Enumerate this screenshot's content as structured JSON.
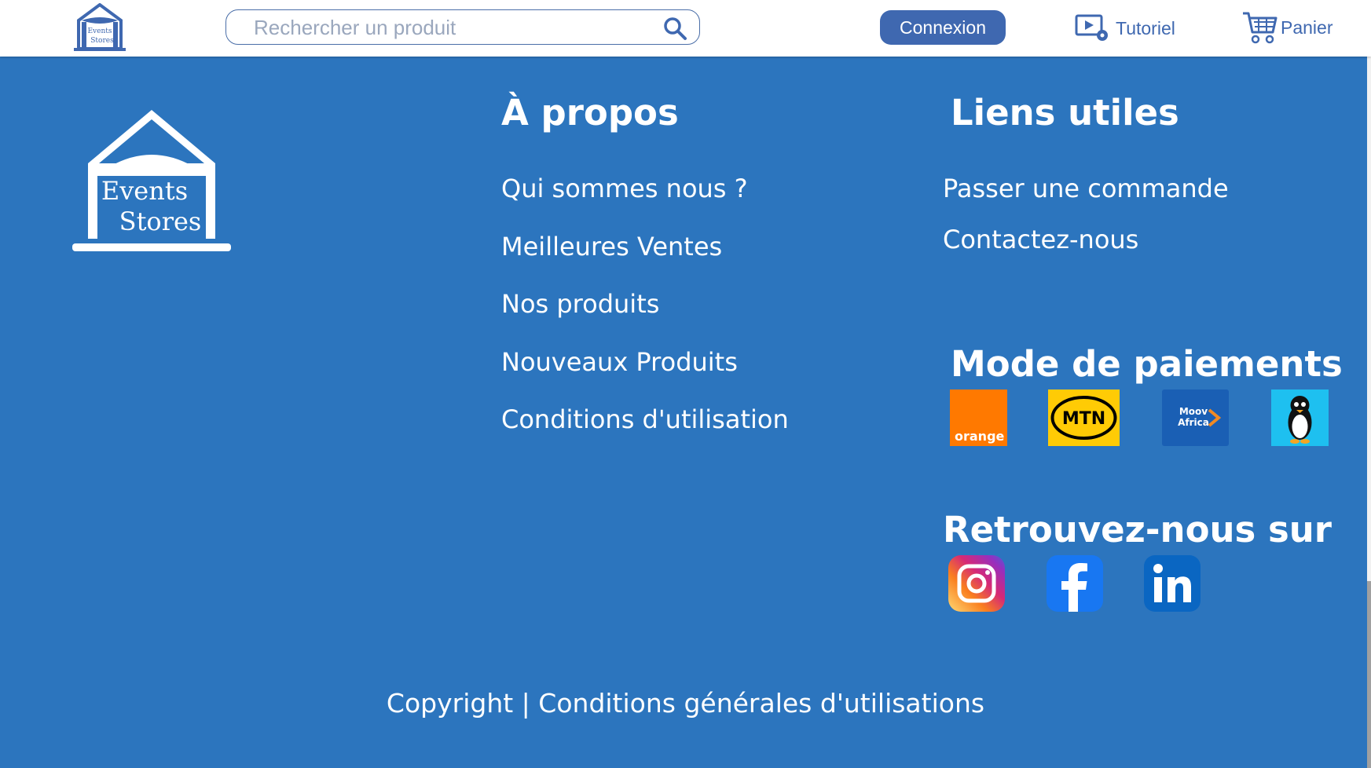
{
  "header": {
    "brand_line1": "Events",
    "brand_line2": "Stores",
    "search_placeholder": "Rechercher un produit",
    "login_label": "Connexion",
    "tutorial_label": "Tutoriel",
    "cart_label": "Panier"
  },
  "footer": {
    "logo_line1": "Events",
    "logo_line2": "Stores",
    "about": {
      "title": "À propos",
      "links": [
        "Qui sommes nous ?",
        "Meilleures Ventes",
        "Nos produits",
        "Nouveaux Produits",
        "Conditions d'utilisation"
      ]
    },
    "useful": {
      "title": "Liens utiles",
      "links": [
        "Passer une commande",
        "Contactez-nous"
      ]
    },
    "payments": {
      "title": "Mode de paiements",
      "methods": [
        "orange",
        "MTN",
        "Moov Africa",
        "penguin-wallet"
      ],
      "orange_text": "orange",
      "mtn_text": "MTN",
      "moov_line1": "Moov",
      "moov_line2": "Africa"
    },
    "social": {
      "title": "Retrouvez-nous sur",
      "networks": [
        "instagram",
        "facebook",
        "linkedin"
      ]
    },
    "copyright": "Copyright",
    "separator": "|",
    "terms": "Conditions générales d'utilisations"
  },
  "colors": {
    "footer_bg": "#2c75be",
    "brand_blue": "#3f68b0",
    "orange": "#ff7900",
    "mtn_yellow": "#ffcb05",
    "moov_blue": "#1a5fb4",
    "facebook": "#1877f2",
    "linkedin": "#0a66c2"
  }
}
